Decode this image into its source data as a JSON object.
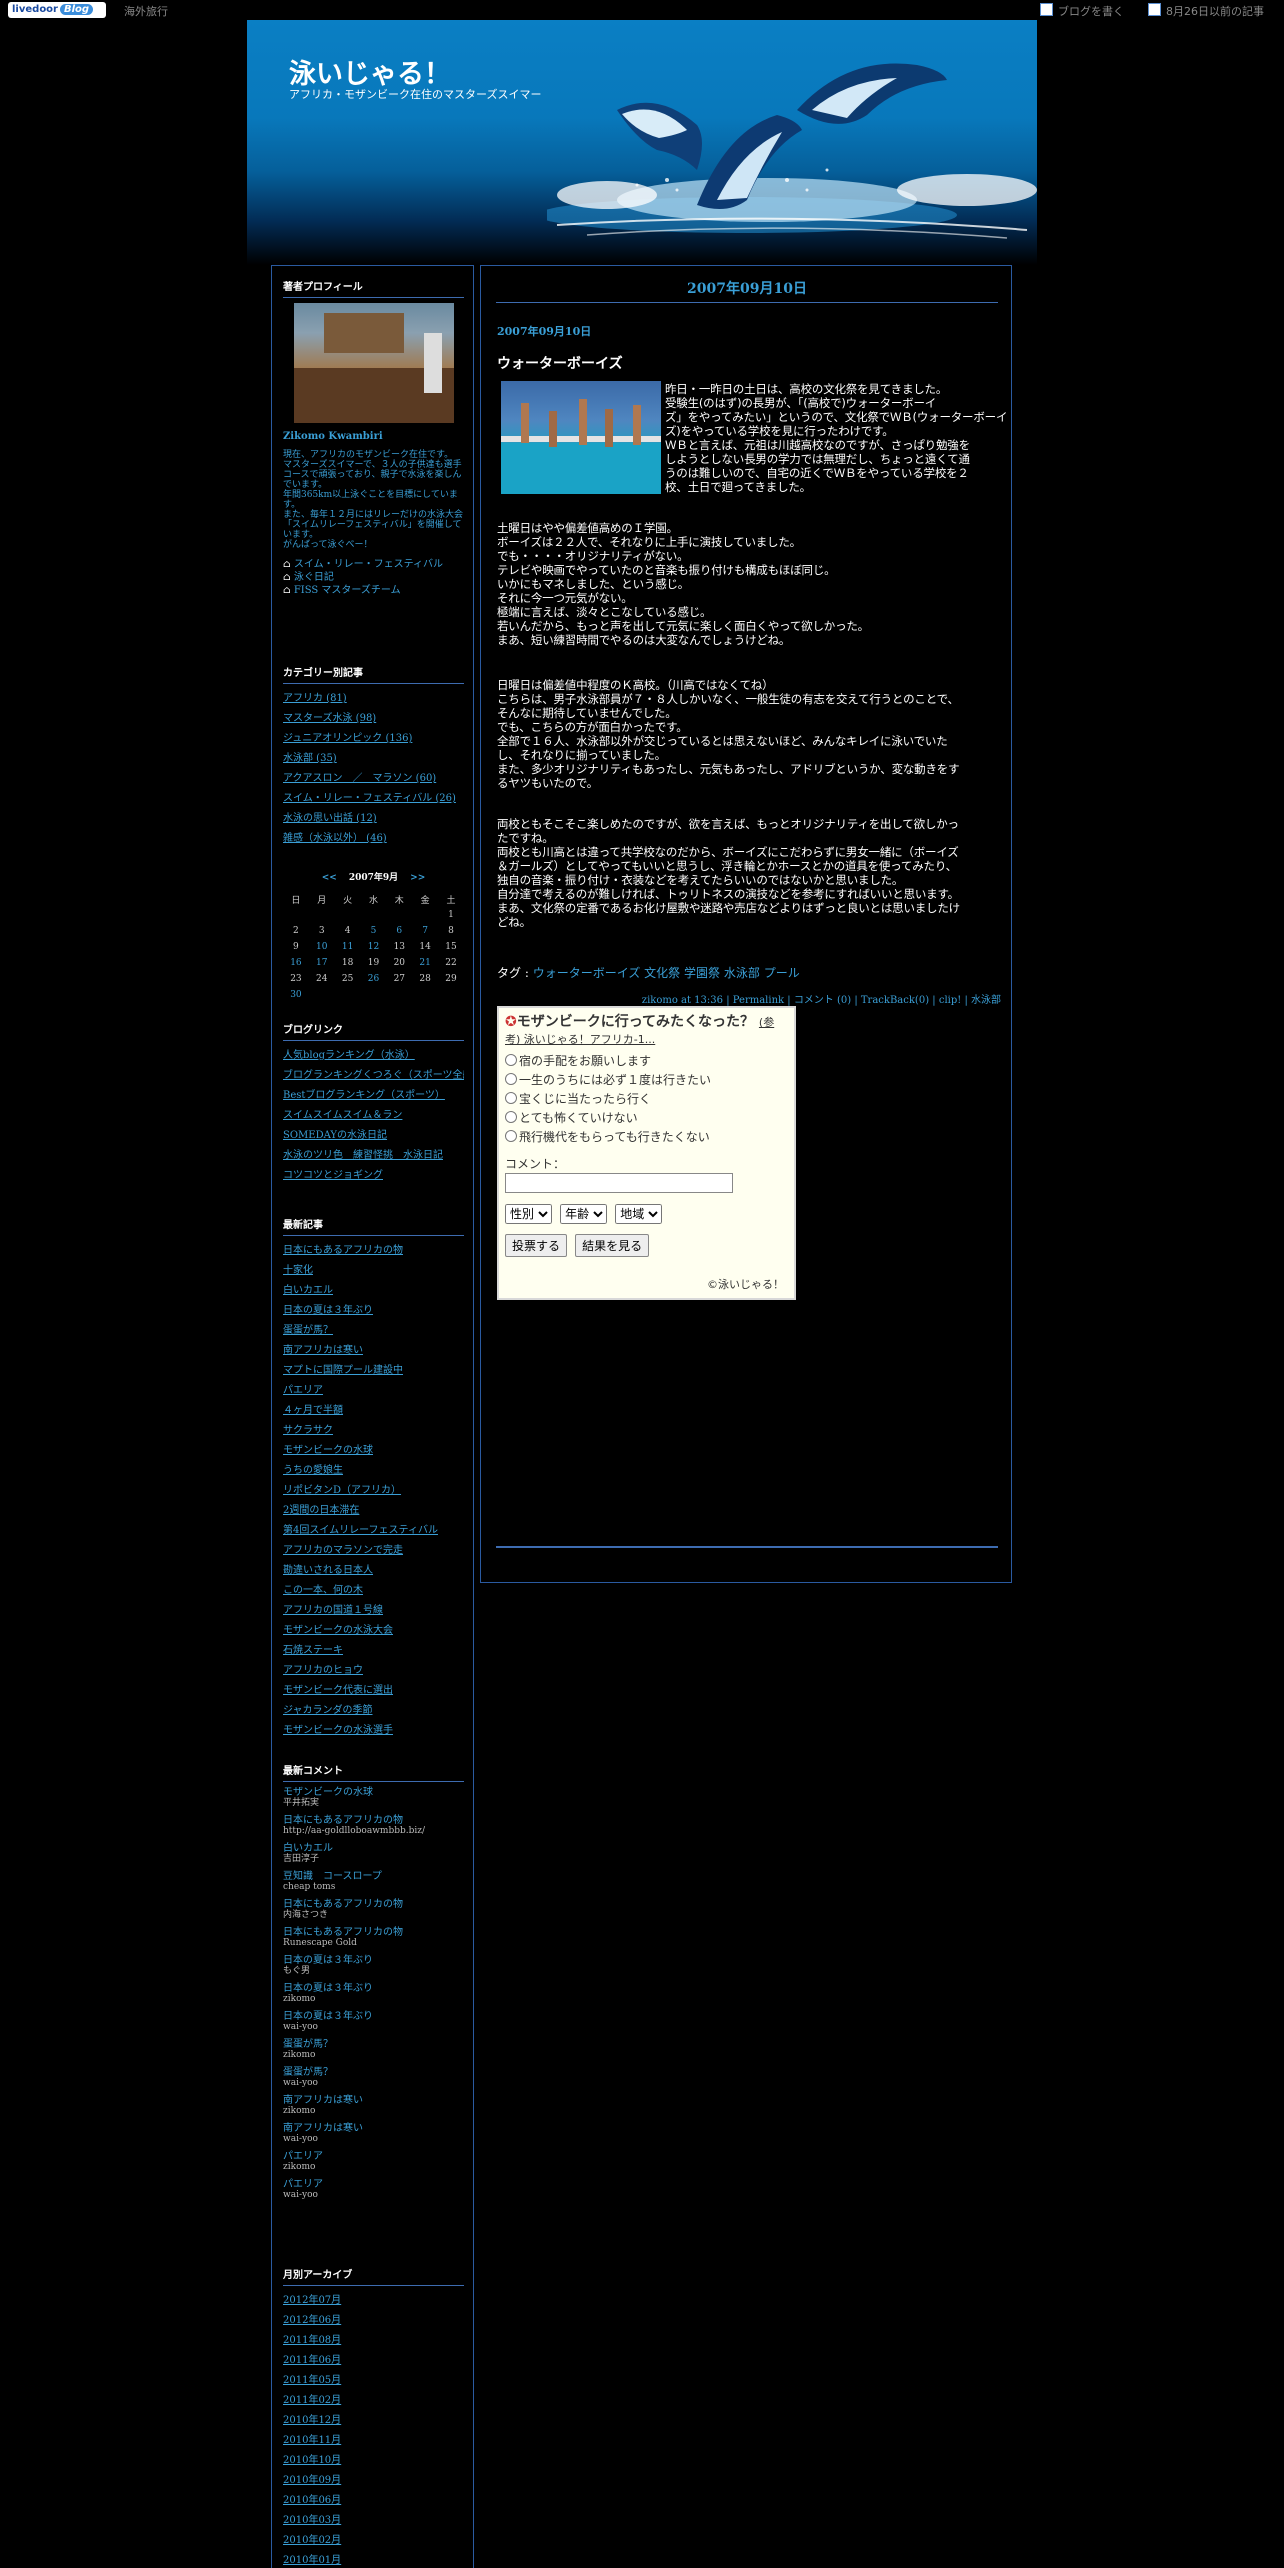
{
  "topbar": {
    "logo": "livedoor",
    "logo_blog": "Blog",
    "category": "海外旅行",
    "write": "ブログを書く",
    "past": "8月26日以前の記事"
  },
  "header": {
    "title": "泳いじゃる！",
    "description": "アフリカ・モザンビーク在住のマスターズスイマー"
  },
  "profile": {
    "heading": "著者プロフィール",
    "name": "Zikomo Kwambiri",
    "bio": [
      "現在、アフリカのモザンビーク在住です。",
      "マスターズスイマーで、３人の子供達も選手コースで頑張っており、親子で水泳を楽しんでいます。",
      "年間365km以上泳ぐことを目標にしています。",
      "また、毎年１２月にはリレーだけの水泳大会「スイムリレーフェスティバル」を開催しています。",
      "がんばって泳ぐべー！"
    ],
    "links": [
      "スイム・リレー・フェスティバル",
      "泳ぐ日記",
      "FISS マスターズチーム"
    ]
  },
  "categories": {
    "heading": "カテゴリー別記事",
    "items": [
      "アフリカ (81)",
      "マスターズ水泳 (98)",
      "ジュニアオリンピック (136)",
      "水泳部 (35)",
      "アクアスロン　／　マラソン (60)",
      "スイム・リレー・フェスティバル (26)",
      "水泳の思い出話 (12)",
      "雑感（水泳以外） (46)"
    ]
  },
  "calendar": {
    "prev": "<<",
    "title": "2007年9月",
    "next": ">>",
    "weekdays": [
      "日",
      "月",
      "火",
      "水",
      "木",
      "金",
      "土"
    ],
    "weeks": [
      [
        "",
        "",
        "",
        "",
        "",
        "",
        "1"
      ],
      [
        "2",
        "3",
        "4",
        "5",
        "6",
        "7",
        "8"
      ],
      [
        "9",
        "10",
        "11",
        "12",
        "13",
        "14",
        "15"
      ],
      [
        "16",
        "17",
        "18",
        "19",
        "20",
        "21",
        "22"
      ],
      [
        "23",
        "24",
        "25",
        "26",
        "27",
        "28",
        "29"
      ],
      [
        "30",
        "",
        "",
        "",
        "",
        "",
        ""
      ]
    ],
    "linked": [
      "5",
      "6",
      "7",
      "10",
      "11",
      "12",
      "16",
      "17",
      "21",
      "26",
      "30"
    ]
  },
  "blog_links": {
    "heading": "ブログリンク",
    "items": [
      "人気blogランキング（水泳）",
      "ブログランキングくつろぐ（スポーツ全般）",
      "Bestブログランキング（スポーツ）",
      "スイムスイムスイム＆ラン",
      "SOMEDAYの水泳日記",
      "水泳のツリ色　練習怪挑　水泳日記",
      "コツコツとジョギング"
    ]
  },
  "recent_posts": {
    "heading": "最新記事",
    "items": [
      "日本にもあるアフリカの物",
      "十家化",
      "白いカエル",
      "日本の夏は３年ぶり",
      "蛋蛋が馬？",
      "南アフリカは寒い",
      "マプトに国際プール建設中",
      "パエリア",
      "４ヶ月で半額",
      "サクラサク",
      "モザンビークの水球",
      "うちの愛娘生",
      "リポビタンD（アフリカ）",
      "2週間の日本滞在",
      "第4回スイムリレーフェスティバル",
      "アフリカのマラソンで完走",
      "勘違いされる日本人",
      "この一本、何の木",
      "アフリカの国道１号線",
      "モザンビークの水泳大会",
      "石焼ステーキ",
      "アフリカのヒョウ",
      "モザンビーク代表に選出",
      "ジャカランダの季節",
      "モザンビークの水泳選手"
    ]
  },
  "recent_comments": {
    "heading": "最新コメント",
    "items": [
      {
        "post": "モザンビークの水球",
        "author": "平井拓実"
      },
      {
        "post": "日本にもあるアフリカの物",
        "author": "http://aa-goldlloboawmbbb.biz/"
      },
      {
        "post": "白いカエル",
        "author": "吉田淳子"
      },
      {
        "post": "豆知識　コースロープ",
        "author": "cheap toms"
      },
      {
        "post": "日本にもあるアフリカの物",
        "author": "内海さつき"
      },
      {
        "post": "日本にもあるアフリカの物",
        "author": "Runescape Gold"
      },
      {
        "post": "日本の夏は３年ぶり",
        "author": "もぐ男"
      },
      {
        "post": "日本の夏は３年ぶり",
        "author": "zikomo"
      },
      {
        "post": "日本の夏は３年ぶり",
        "author": "wai-yoo"
      },
      {
        "post": "蛋蛋が馬？",
        "author": "zikomo"
      },
      {
        "post": "蛋蛋が馬？",
        "author": "wai-yoo"
      },
      {
        "post": "南アフリカは寒い",
        "author": "zikomo"
      },
      {
        "post": "南アフリカは寒い",
        "author": "wai-yoo"
      },
      {
        "post": "パエリア",
        "author": "zikomo"
      },
      {
        "post": "パエリア",
        "author": "wai-yoo"
      }
    ]
  },
  "archives": {
    "heading": "月別アーカイブ",
    "items": [
      "2012年07月",
      "2012年06月",
      "2011年08月",
      "2011年06月",
      "2011年05月",
      "2011年02月",
      "2010年12月",
      "2010年11月",
      "2010年10月",
      "2010年09月",
      "2010年06月",
      "2010年03月",
      "2010年02月",
      "2010年01月"
    ]
  },
  "post": {
    "date_header": "2007年09月10日",
    "date": "2007年09月10日",
    "title": "ウォーターボーイズ",
    "para_beside": [
      "昨日・一昨日の土日は、高校の文化祭を見てきました。",
      "受験生(のはず)の長男が、「(高校で)ウォーターボーイ",
      "ズ」をやってみたい」というので、文化祭でＷＢ(ウォーターボーイ",
      "ズ)をやっている学校を見に行ったわけです。",
      "ＷＢと言えば、元祖は川越高校なのですが、さっぱり勉強を",
      "しようとしない長男の学力では無理だし、ちょっと遠くて通",
      "うのは難しいので、自宅の近くでＷＢをやっている学校を２",
      "校、土日で廻ってきました。"
    ],
    "para2": [
      "土曜日はやや偏差値高めのＩ学園。",
      "ボーイズは２２人で、それなりに上手に演技していました。",
      "でも・・・・オリジナリティがない。",
      "テレビや映画でやっていたのと音楽も振り付けも構成もほぼ同じ。",
      "いかにもマネしました、という感じ。",
      "それに今一つ元気がない。",
      "極端に言えば、淡々とこなしている感じ。",
      "若いんだから、もっと声を出して元気に楽しく面白くやって欲しかった。",
      "まあ、短い練習時間でやるのは大変なんでしょうけどね。"
    ],
    "para3": [
      "日曜日は偏差値中程度のＫ高校。（川高ではなくてね）",
      "こちらは、男子水泳部員が７・８人しかいなく、一般生徒の有志を交えて行うとのことで、",
      "そんなに期待していませんでした。",
      "でも、こちらの方が面白かったです。",
      "全部で１６人、水泳部以外が交じっているとは思えないほど、みんなキレイに泳いでいた",
      "し、それなりに揃っていました。",
      "また、多少オリジナリティもあったし、元気もあったし、アドリブというか、変な動きをす",
      "るヤツもいたので。"
    ],
    "para4": [
      "両校ともそこそこ楽しめたのですが、欲を言えば、もっとオリジナリティを出して欲しかっ",
      "たですね。",
      "両校とも川高とは違って共学校なのだから、ボーイズにこだわらずに男女一緒に（ボーイズ",
      "＆ガールズ）としてやってもいいと思うし、浮き輪とかホースとかの道具を使ってみたり、",
      "独自の音楽・振り付け・衣装などを考えてたらいいのではないかと思いました。",
      "自分達で考えるのが難しければ、トゥリトネスの演技などを参考にすればいいと思います。",
      "まあ、文化祭の定番であるお化け屋敷や迷路や売店などよりはずっと良いとは思いましたけ",
      "どね。"
    ],
    "tags_label": "タグ :",
    "tags": [
      "ウォーターボーイズ",
      "文化祭",
      "学園祭",
      "水泳部",
      "プール"
    ],
    "footer": {
      "author_time": "zikomo at 13:36",
      "permalink": "Permalink",
      "comment": "コメント (0)",
      "trackback": "TrackBack(0)",
      "clip": "clip!",
      "category": "水泳部"
    }
  },
  "poll": {
    "question": "モザンビークに行ってみたくなった？",
    "ref": "(参考) 泳いじゃる！アフリカ-1...",
    "options": [
      "宿の手配をお願いします",
      "一生のうちには必ず１度は行きたい",
      "宝くじに当たったら行く",
      "とても怖くていけない",
      "飛行機代をもらっても行きたくない"
    ],
    "comment_label": "コメント：",
    "select_gender": "性別",
    "select_age": "年齢",
    "select_region": "地域",
    "vote_button": "投票する",
    "result_button": "結果を見る",
    "credit": "©泳いじゃる！"
  }
}
